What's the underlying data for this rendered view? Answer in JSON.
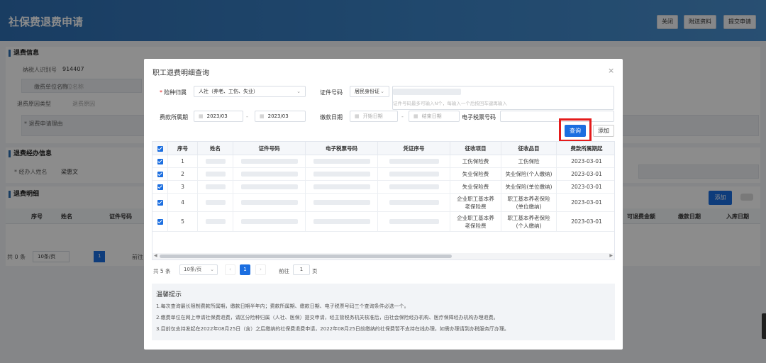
{
  "page": {
    "title": "社保费退费申请",
    "header_buttons": [
      "关闭",
      "附送资料",
      "提交申请"
    ]
  },
  "background": {
    "section_refund_info": "退费信息",
    "taxpayer_id_label": "纳税人识别号",
    "taxpayer_id_value": "914407",
    "unit_name_label": "缴费单位名称",
    "unit_name_value": "单位名称",
    "refund_type_label": "退费原因类型",
    "refund_type_value": "退费原因",
    "refund_reason_label": "* 退费申请理由",
    "section_handler": "退费经办信息",
    "handler_label": "* 经办人姓名",
    "handler_value": "梁惠文",
    "section_detail": "退费明细",
    "add_label": "添加",
    "table_headers": [
      "序号",
      "姓名",
      "证件号码",
      "可退费金额",
      "缴款日期",
      "入库日期"
    ],
    "pager_total": "共 0 条",
    "pager_size": "10条/页",
    "pager_page": "1",
    "pager_goto": "前往"
  },
  "modal": {
    "title": "职工退费明细查询",
    "close": "×",
    "insurance_label": "险种归属",
    "insurance_value": "人社（养老、工伤、失业）",
    "id_label": "证件号码",
    "id_type": "居民身份证",
    "id_hint": "证件号码最多可输入N个，每输入一个后按回车键再输入",
    "period_label": "费款所属期",
    "period_start": "2023/03",
    "period_sep": "-",
    "period_end": "2023/03",
    "pay_date_label": "缴款日期",
    "pay_date_start": "开始日期",
    "pay_date_end": "结束日期",
    "pay_date_sep": "-",
    "ticket_label": "电子税票号码",
    "query_button": "查询",
    "add_button": "添加",
    "table": {
      "headers": [
        "序号",
        "姓名",
        "证件号码",
        "电子税票号码",
        "凭证序号",
        "征收项目",
        "征收品目",
        "费款所属期起"
      ],
      "rows": [
        {
          "no": "1",
          "item": "工伤保险费",
          "sub": "工伤保险",
          "period": "2023-03-01"
        },
        {
          "no": "2",
          "item": "失业保险费",
          "sub": "失业保险(个人缴纳)",
          "period": "2023-03-01"
        },
        {
          "no": "3",
          "item": "失业保险费",
          "sub": "失业保险(单位缴纳)",
          "period": "2023-03-01"
        },
        {
          "no": "4",
          "item": "企业职工基本养老保险费",
          "sub": "职工基本养老保险(单位缴纳)",
          "period": "2023-03-01"
        },
        {
          "no": "5",
          "item": "企业职工基本养老保险费",
          "sub": "职工基本养老保险(个人缴纳)",
          "period": "2023-03-01"
        }
      ]
    },
    "pager": {
      "total": "共 5 条",
      "size": "10条/页",
      "prev": "‹",
      "page": "1",
      "next": "›",
      "goto": "前往",
      "goto_value": "1",
      "page_unit": "页"
    },
    "tips": {
      "title": "温馨提示",
      "lines": [
        "1.每次查询最长限制费款所属期，缴款日期半年内；费款所属期、缴款日期、电子税票号码三个查询条件必选一个。",
        "2.缴费单位在网上申请社保费退费，请区分险种归属（人社、医保）提交申请，经主管税务机关核准后，由社会保险经办机构、医疗保障经办机构办理退费。",
        "3.目前仅支持发起在2022年08月25日（含）之后缴纳的社保费退费申请，2022年08月25日前缴纳的社保费暂不支持在线办理，如需办理请到办税服务厅办理。"
      ]
    }
  },
  "colors": {
    "primary": "#1b6ee0",
    "highlight": "#e41b1b",
    "header": "#2f6fb3"
  }
}
